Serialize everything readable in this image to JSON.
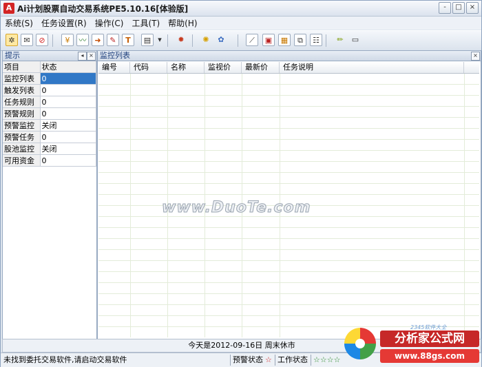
{
  "window": {
    "title": "Ai计划股票自动交易系统PE5.10.16[体验版]",
    "app_icon_letter": "A",
    "buttons": [
      "-",
      "□",
      "×"
    ]
  },
  "menu": [
    "系统(S)",
    "任务设置(R)",
    "操作(C)",
    "工具(T)",
    "帮助(H)"
  ],
  "toolbar": {
    "icons": [
      "pointer-icon",
      "mail-icon",
      "stop-icon",
      "stock-icon",
      "chart-icon",
      "arrow-icon",
      "settings-icon",
      "text-t-icon",
      "report-icon",
      "dropdown-arrow-icon",
      "sun-icon",
      "bulb-icon",
      "gear-check-icon",
      "line-chart-icon",
      "monitor-icon",
      "calculator-icon",
      "network-icon",
      "table-icon",
      "pen-icon",
      "minus-icon"
    ],
    "text_t": "T"
  },
  "left_panel": {
    "title": "提示",
    "headers": [
      "项目",
      "状态"
    ],
    "rows": [
      {
        "key": "监控列表",
        "value": "0"
      },
      {
        "key": "触发列表",
        "value": "0"
      },
      {
        "key": "任务规则",
        "value": "0"
      },
      {
        "key": "预警规则",
        "value": "0"
      },
      {
        "key": "预警监控",
        "value": "关闭"
      },
      {
        "key": "预警任务",
        "value": "0"
      },
      {
        "key": "股池监控",
        "value": "关闭"
      },
      {
        "key": "可用资金",
        "value": "0"
      }
    ]
  },
  "main_panel": {
    "title": "监控列表",
    "columns": [
      "编号",
      "代码",
      "名称",
      "监视价",
      "最新价",
      "任务说明"
    ],
    "watermark": "www.DuoTe.com"
  },
  "date_bar": "今天是2012-09-16日  周末休市",
  "status": {
    "message": "未找到委托交易软件,请启动交易软件",
    "alert_label": "预警状态",
    "work_label": "工作状态",
    "stars": "☆☆☆☆"
  },
  "badge": {
    "title": "分析家公式网",
    "url": "www.88gs.com",
    "small": "2345软件大全"
  }
}
